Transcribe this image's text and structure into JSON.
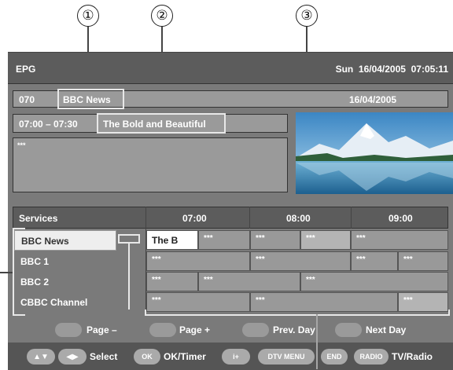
{
  "callouts": [
    "①",
    "②",
    "③"
  ],
  "header": {
    "title": "EPG",
    "datetime": "Sun  16/04/2005  07:05:11"
  },
  "info": {
    "channel_number": "070",
    "channel_name": "BBC News",
    "date": "16/04/2005",
    "time_range": "07:00 – 07:30",
    "programme": "The Bold and Beautiful",
    "description": "***"
  },
  "grid": {
    "services_header": "Services",
    "times": [
      "07:00",
      "08:00",
      "09:00"
    ],
    "services": [
      "BBC News",
      "BBC 1",
      "BBC 2",
      "CBBC Channel"
    ],
    "rows": [
      [
        "The B",
        "***",
        "***",
        "***",
        "***"
      ],
      [
        "***",
        "***",
        "***",
        "***"
      ],
      [
        "***",
        "***",
        "***"
      ],
      [
        "***",
        "***",
        "***"
      ]
    ]
  },
  "color_buttons": [
    "Page –",
    "Page +",
    "Prev. Day",
    "Next Day"
  ],
  "bottom_bar": {
    "select": "Select",
    "ok": "OK",
    "ok_timer": "OK/Timer",
    "info": "i+",
    "dtv_menu": "DTV MENU",
    "end": "END",
    "radio": "RADIO",
    "tv_radio": "TV/Radio"
  },
  "colors": {
    "screen": "#7a7a7a",
    "bar": "#5c5c5c",
    "highlight": "#e8e8e8"
  }
}
